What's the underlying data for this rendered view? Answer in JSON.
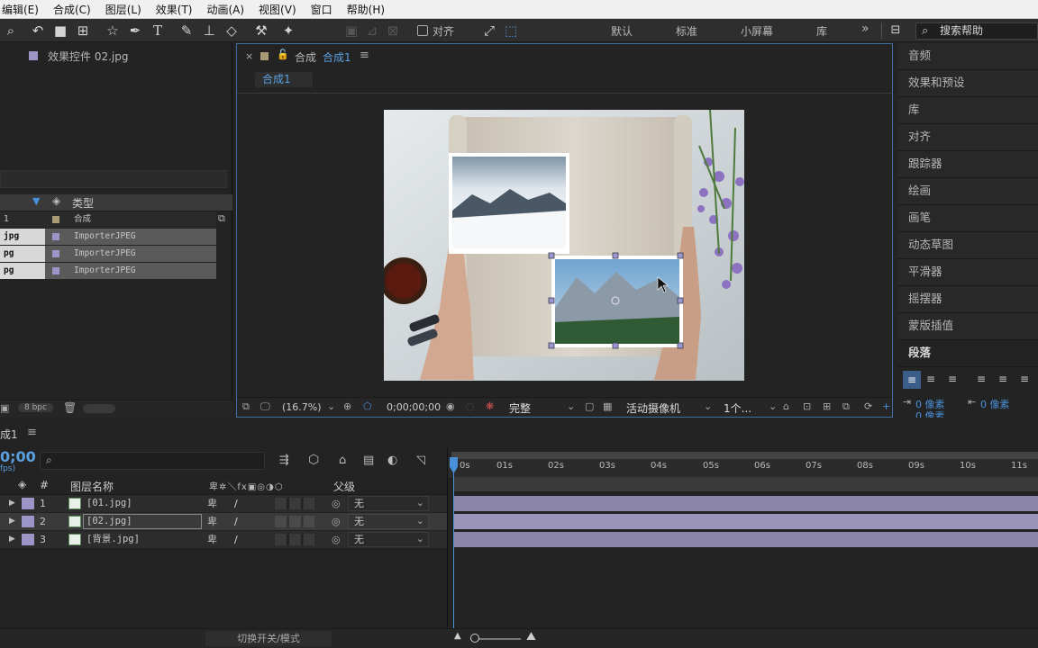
{
  "menubar": {
    "items": [
      "编辑(E)",
      "合成(C)",
      "图层(L)",
      "效果(T)",
      "动画(A)",
      "视图(V)",
      "窗口",
      "帮助(H)"
    ]
  },
  "toolbar": {
    "align_label": "对齐",
    "workspaces": [
      "默认",
      "标准",
      "小屏幕",
      "库"
    ],
    "overflow": "»",
    "search_placeholder": "搜索帮助"
  },
  "project": {
    "selected_item": "效果控件 02.jpg",
    "column_type": "类型",
    "rows": [
      {
        "name": "1",
        "type": "合成",
        "color": "#a89a74"
      },
      {
        "name": "jpg",
        "type": "ImporterJPEG",
        "color": "#9c96c8"
      },
      {
        "name": "pg",
        "type": "ImporterJPEG",
        "color": "#9c96c8"
      },
      {
        "name": "pg",
        "type": "ImporterJPEG",
        "color": "#9c96c8"
      }
    ],
    "bpc": "8 bpc"
  },
  "comp": {
    "tab_label": "合成",
    "tab_active": "合成1",
    "breadcrumb": "合成1",
    "zoom": "(16.7%)",
    "timecode": "0;00;00;00",
    "quality": "完整",
    "camera": "活动摄像机",
    "views": "1个..."
  },
  "right_panel": {
    "items": [
      "音频",
      "效果和预设",
      "库",
      "对齐",
      "跟踪器",
      "绘画",
      "画笔",
      "动态草图",
      "平滑器",
      "摇摆器",
      "蒙版插值",
      "段落"
    ],
    "para_units_1": "0 像素",
    "para_units_2": "0 像素",
    "para_units_3": "0 像素"
  },
  "timeline": {
    "comp_tab": "成1",
    "current_time": "0;00",
    "fps": "fps)",
    "col_num": "#",
    "col_name": "图层名称",
    "col_parent": "父级",
    "layers": [
      {
        "num": "1",
        "name": "[01.jpg]",
        "parent": "无",
        "color": "#9c96c8"
      },
      {
        "num": "2",
        "name": "[02.jpg]",
        "parent": "无",
        "color": "#9c96c8"
      },
      {
        "num": "3",
        "name": "[背景.jpg]",
        "parent": "无",
        "color": "#9c96c8"
      }
    ],
    "ruler": [
      "0s",
      "01s",
      "02s",
      "03s",
      "04s",
      "05s",
      "06s",
      "07s",
      "08s",
      "09s",
      "10s",
      "11s"
    ],
    "footer_label": "切换开关/模式"
  }
}
